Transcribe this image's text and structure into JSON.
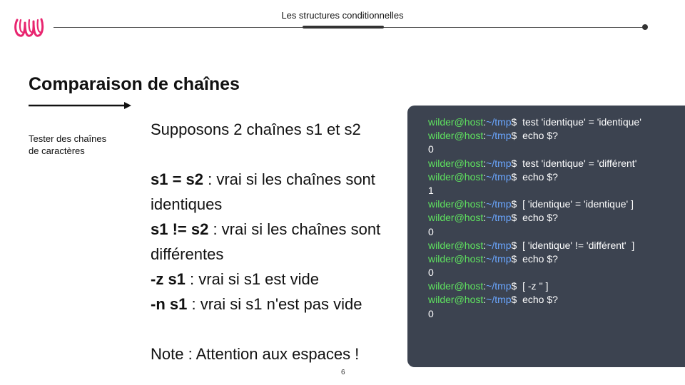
{
  "header": {
    "title": "Les structures conditionnelles"
  },
  "slide": {
    "title": "Comparaison de chaînes",
    "side_note": "Tester des chaînes de caractères",
    "intro": "Supposons 2 chaînes s1 et s2",
    "rules": [
      {
        "op": "s1 = s2",
        "text": " : vrai si les chaînes sont identiques"
      },
      {
        "op": "s1 != s2",
        "text": " : vrai si les chaînes sont différentes"
      },
      {
        "op": "-z s1",
        "text": " : vrai si s1 est vide"
      },
      {
        "op": "-n s1",
        "text": " : vrai si s1 n'est pas vide"
      }
    ],
    "note": "Note : Attention aux espaces !",
    "page_number": "6"
  },
  "terminal": {
    "user": "wilder@host",
    "path": "~/tmp",
    "colors": {
      "background": "#3c4350",
      "user": "#5fe35f",
      "path": "#6aa6ff",
      "text": "#ffffff"
    },
    "lines": [
      {
        "kind": "prompt",
        "user": "wilder@host",
        "sep": ":",
        "path": "~/tmp",
        "cmd": "$  test 'identique' = 'identique'"
      },
      {
        "kind": "prompt",
        "user": "wilder@host",
        "sep": ":",
        "path": "~/tmp",
        "cmd": "$  echo $?"
      },
      {
        "kind": "output",
        "text": "0"
      },
      {
        "kind": "prompt",
        "user": "wilder@host",
        "sep": ":",
        "path": "~/tmp",
        "cmd": "$  test 'identique' = 'différent'"
      },
      {
        "kind": "prompt",
        "user": "wilder@host",
        "sep": ":",
        "path": "~/tmp",
        "cmd": "$  echo $?"
      },
      {
        "kind": "output",
        "text": "1"
      },
      {
        "kind": "prompt",
        "user": "wilder@host",
        "sep": ":",
        "path": "~/tmp",
        "cmd": "$  [ 'identique' = 'identique' ]"
      },
      {
        "kind": "prompt",
        "user": "wilder@host",
        "sep": ":",
        "path": "~/tmp",
        "cmd": "$  echo $?"
      },
      {
        "kind": "output",
        "text": "0"
      },
      {
        "kind": "prompt",
        "user": "wilder@host",
        "sep": ":",
        "path": "~/tmp",
        "cmd": "$  [ 'identique' != 'différent'  ]"
      },
      {
        "kind": "prompt",
        "user": "wilder@host",
        "sep": ":",
        "path": "~/tmp",
        "cmd": "$  echo $?"
      },
      {
        "kind": "output",
        "text": "0"
      },
      {
        "kind": "prompt",
        "user": "wilder@host",
        "sep": ":",
        "path": "~/tmp",
        "cmd": "$  [ -z '' ]"
      },
      {
        "kind": "prompt",
        "user": "wilder@host",
        "sep": ":",
        "path": "~/tmp",
        "cmd": "$  echo $?"
      },
      {
        "kind": "output",
        "text": "0"
      }
    ]
  },
  "brand": {
    "logo_icon": "wild-code-school-logo-icon",
    "accent_color": "#e8256f"
  }
}
